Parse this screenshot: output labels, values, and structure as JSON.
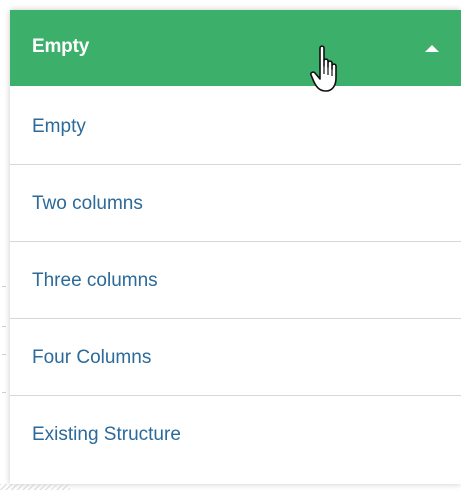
{
  "dropdown": {
    "selected": "Empty",
    "options": [
      {
        "label": "Empty"
      },
      {
        "label": "Two columns"
      },
      {
        "label": "Three columns"
      },
      {
        "label": "Four Columns"
      },
      {
        "label": "Existing Structure"
      }
    ]
  },
  "icons": {
    "caret": "caret-up-icon",
    "cursor": "hand-cursor-icon"
  },
  "colors": {
    "header_bg": "#3cb06b",
    "header_text": "#ffffff",
    "option_text": "#2b6a9a",
    "divider": "#d7d7d7"
  }
}
